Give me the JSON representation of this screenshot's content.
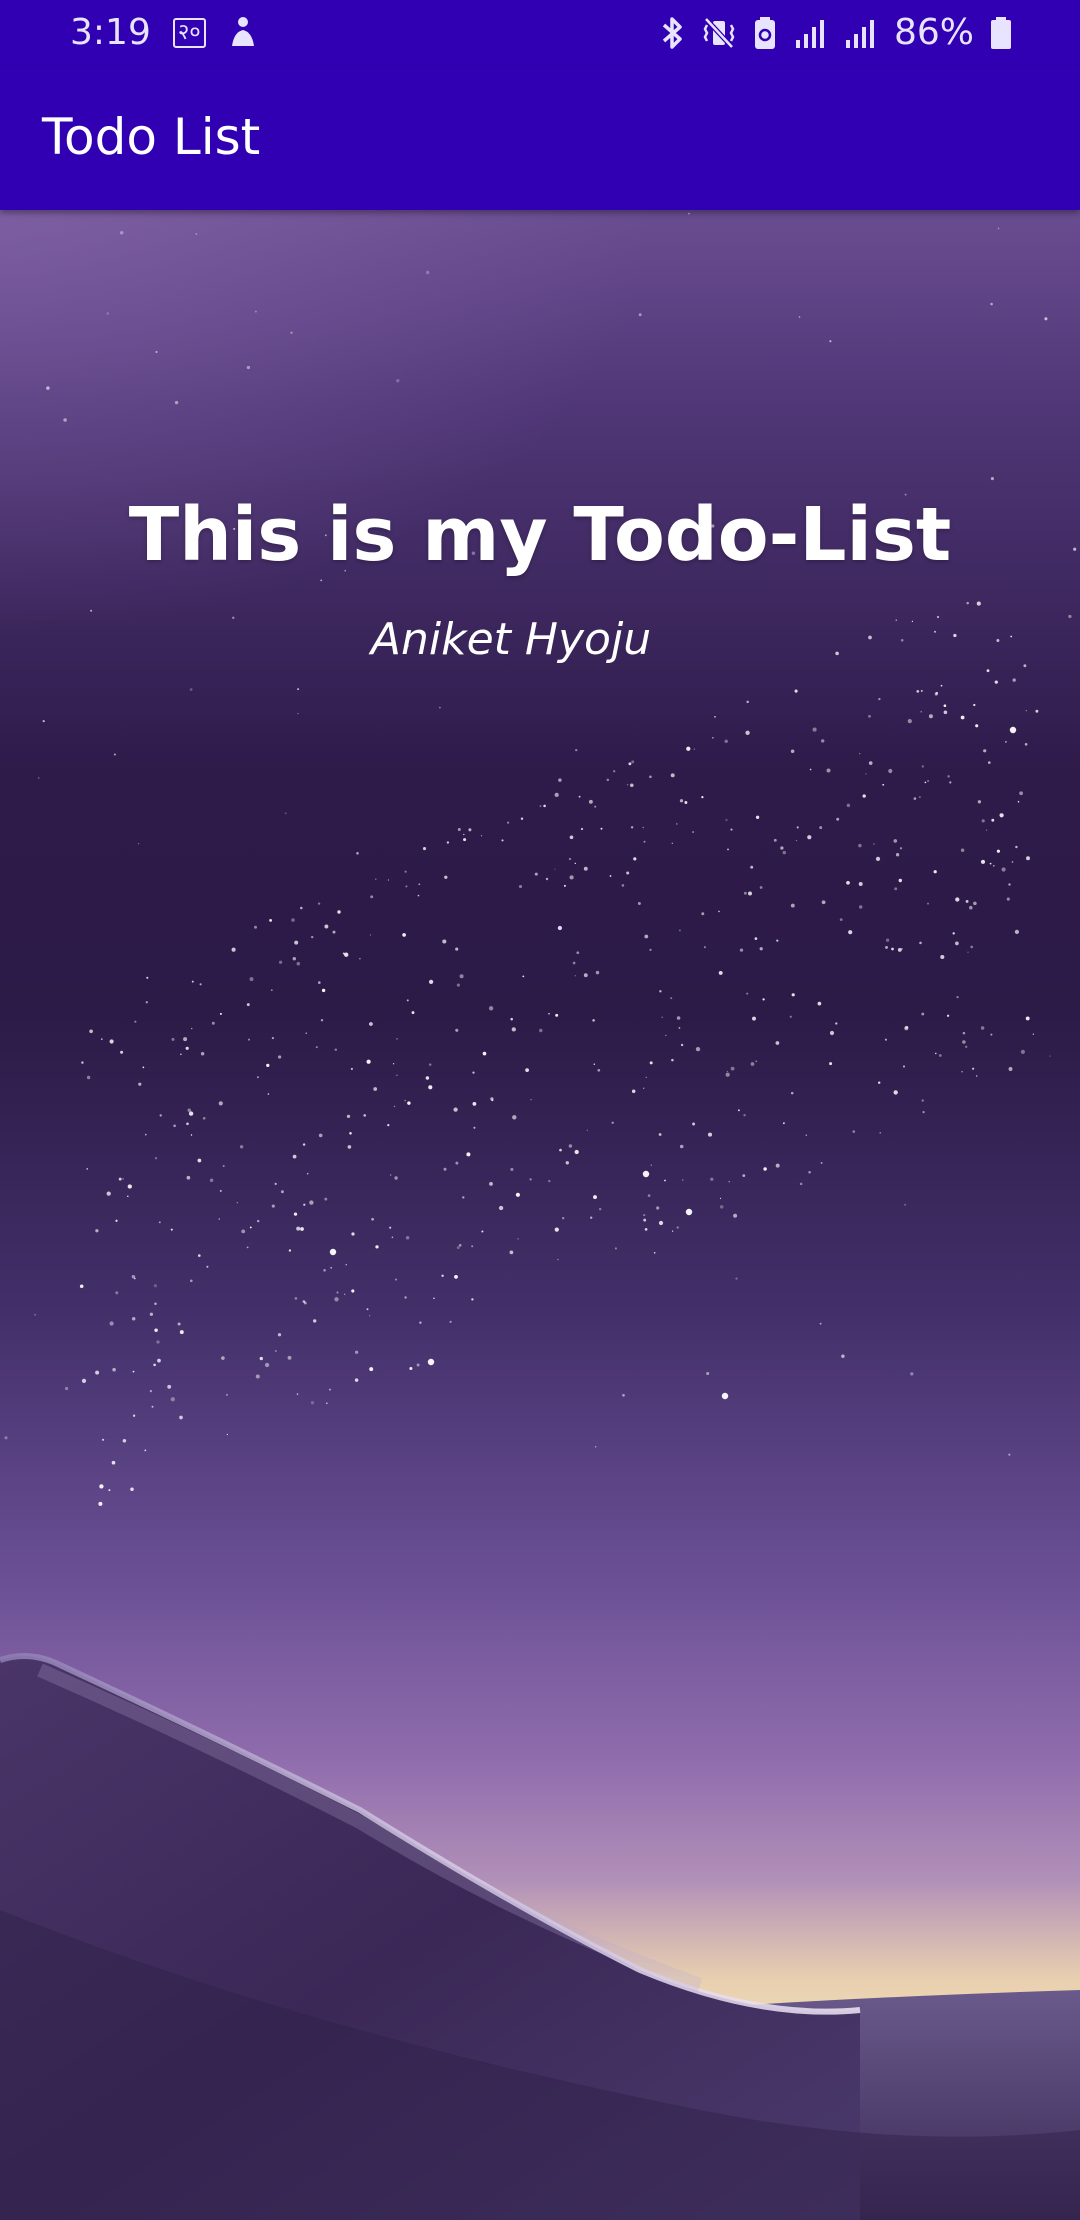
{
  "status_bar": {
    "time": "3:19",
    "notification_glyph": "२०",
    "battery_percent": "86%",
    "icons": [
      "bluetooth-icon",
      "vibrate-icon",
      "battery-saver-icon",
      "signal-icon",
      "signal-icon",
      "battery-icon"
    ]
  },
  "app_bar": {
    "title": "Todo List",
    "color": "#3200b3"
  },
  "content": {
    "headline": "This is my Todo-List",
    "author": "Aniket Hyoju"
  }
}
